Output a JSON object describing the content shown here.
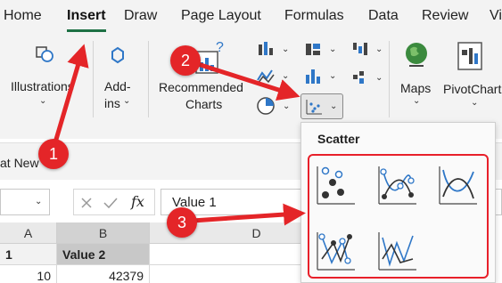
{
  "ribbon_tabs": {
    "home": "Home",
    "insert": "Insert",
    "draw": "Draw",
    "page_layout": "Page Layout",
    "formulas": "Formulas",
    "data": "Data",
    "review": "Review",
    "view": "Vi"
  },
  "groups": {
    "illustrations": "Illustrations",
    "addins_line1": "Add-",
    "addins_line2": "ins",
    "recommended_line1": "Recommended",
    "recommended_line2": "Charts",
    "maps": "Maps",
    "pivotchart": "PivotChart"
  },
  "format_row": {
    "label": "at New"
  },
  "formula_bar": {
    "fx": "fx",
    "value": "Value 1"
  },
  "grid": {
    "columns": [
      "A",
      "B",
      "D"
    ],
    "rows": [
      [
        "1",
        "Value 2"
      ],
      [
        "10",
        "42379"
      ]
    ]
  },
  "scatter_menu": {
    "title": "Scatter",
    "options": [
      "scatter-markers-icon",
      "scatter-smooth-lines-markers-icon",
      "scatter-smooth-lines-icon",
      "scatter-straight-lines-markers-icon",
      "scatter-straight-lines-icon"
    ]
  },
  "callouts": {
    "step1": "1",
    "step2": "2",
    "step3": "3"
  },
  "colors": {
    "accent_green": "#1e7145",
    "callout_red": "#e42528",
    "chart_blue": "#2f77c7"
  }
}
